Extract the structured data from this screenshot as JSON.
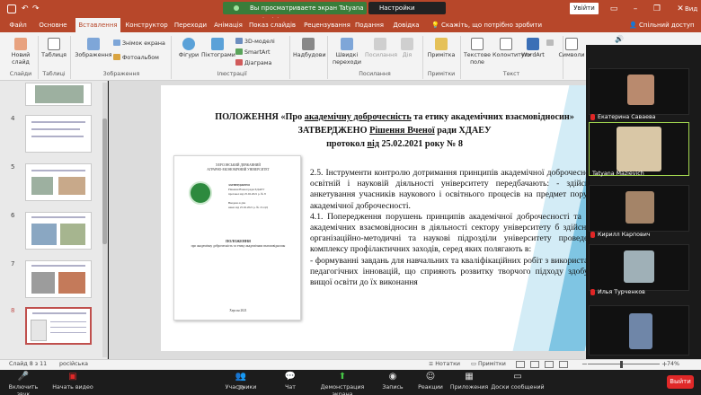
{
  "titlebar": {
    "banner": "Вы просматриваете экран Tatyana Mazievich",
    "view_settings": "Настройки просмотра",
    "signin": "Увійти",
    "minimize": "–",
    "restore": "❐",
    "close": "✕"
  },
  "tabs": [
    "Файл",
    "Основне",
    "Вставлення",
    "Конструктор",
    "Переходи",
    "Анімація",
    "Показ слайдів",
    "Рецензування",
    "Подання",
    "Довідка"
  ],
  "active_tab": "Вставлення",
  "tell_me": "Скажіть, що потрібно зробити",
  "share": "Спільний доступ",
  "ribbon": {
    "new_slide": "Новий слайд",
    "table": "Таблиця",
    "images": "Зображення",
    "screenshot": "Знімок екрана",
    "photo_album": "Фотоальбом",
    "shapes": "Фігури",
    "icons": "Піктограми",
    "models3d": "3D-моделі",
    "smartart": "SmartArt",
    "chart": "Діаграма",
    "addins": "Надбудови",
    "quick_links": "Швидкі переходи",
    "link": "Посилання",
    "action": "Дія",
    "comment": "Примітка",
    "textbox": "Текстове поле",
    "header_footer": "Колонтитули",
    "wordart": "WordArt",
    "symbols": "Символи",
    "groups": {
      "slides": "Слайди",
      "tables": "Таблиці",
      "images": "Зображення",
      "illustrations": "Ілюстрації",
      "links": "Посилання",
      "comments": "Примітки",
      "text": "Текст"
    }
  },
  "thumbnails": [
    "4",
    "5",
    "6",
    "7",
    "8"
  ],
  "selected_thumbnail": "8",
  "slide": {
    "title_line1_a": "ПОЛОЖЕННЯ «Про ",
    "title_line1_u": "академічну доброчесність",
    "title_line1_b": " та етику академічних взаємовідносин»",
    "title_line2_a": "ЗАТВЕРДЖЕНО ",
    "title_line2_u": "Рішення Вченої",
    "title_line2_b": " ради ХДАЕУ",
    "title_line3_a": "протокол ",
    "title_line3_u": "від",
    "title_line3_b": " 25.02.2021 року № 8",
    "body": [
      "2.5. Інструменти контролю дотримання принципів академічної доброчесності в освітній і науковій діяльності університету передбачають: - здійснення анкетування учасників наукового і освітнього процесів на предмет порушень академічної доброчесності.",
      "4.1. Попередження порушень принципів академічної доброчесності та етики академічних взаємовідносин в діяльності сектору університету б здійснюють організаційно-методичні та наукові підрозділи університету проведенням комплексу профілактичних заходів, серед яких полягають в:",
      "- формуванні завдань для навчальних та кваліфікаційних робіт з використанням педагогічних інновацій, що сприяють розвитку творчого підходу здобувачів вищої освіти до їх виконання"
    ],
    "doc": {
      "university_line1": "ХЕРСОНСЬКИЙ ДЕРЖАВНИЙ",
      "university_line2": "АГРАРНО-ЕКОНОМІЧНИЙ УНІВЕРСИТЕТ",
      "approved": "ЗАТВЕРДЖЕНО",
      "approved_detail1": "Рішення Вченої ради ХДАЕУ",
      "approved_detail2": "протокол від 25.02.2021 р. № 8",
      "enacted": "Введено в дію",
      "enacted_detail": "наказ від 25.02.2021 р. № 15-ОД",
      "doc_title": "ПОЛОЖЕННЯ",
      "doc_subtitle": "про академічну доброчесність та етику академічних взаємовідносин",
      "city_year": "Херсон 2021"
    }
  },
  "participants": [
    {
      "name": "Екатерина Саваева",
      "active": false,
      "muted": true
    },
    {
      "name": "Tatyana Mazievich",
      "active": true,
      "muted": false
    },
    {
      "name": "Кирилл Карпович",
      "active": false,
      "muted": true
    },
    {
      "name": "Илья Турченков",
      "active": false,
      "muted": true
    },
    {
      "name": "",
      "active": false,
      "muted": false
    }
  ],
  "status": {
    "slide_of": "Слайд 8 з 11",
    "language": "російська",
    "notes": "Нотатки",
    "comments": "Примітки",
    "zoom": "74%"
  },
  "meeting": {
    "audio": "Включить звук",
    "video": "Начать видео",
    "participants_count": "10",
    "participants": "Участники",
    "chat": "Чат",
    "share_screen": "Демонстрация экрана",
    "record": "Запись",
    "reactions": "Реакции",
    "apps": "Приложения",
    "whiteboards": "Доски сообщений",
    "leave": "Выйти"
  },
  "colors": {
    "accent": "#b7472a",
    "selected_thumb": "#c0504d",
    "active_speaker": "#a2d64f",
    "leave": "#e02828"
  }
}
